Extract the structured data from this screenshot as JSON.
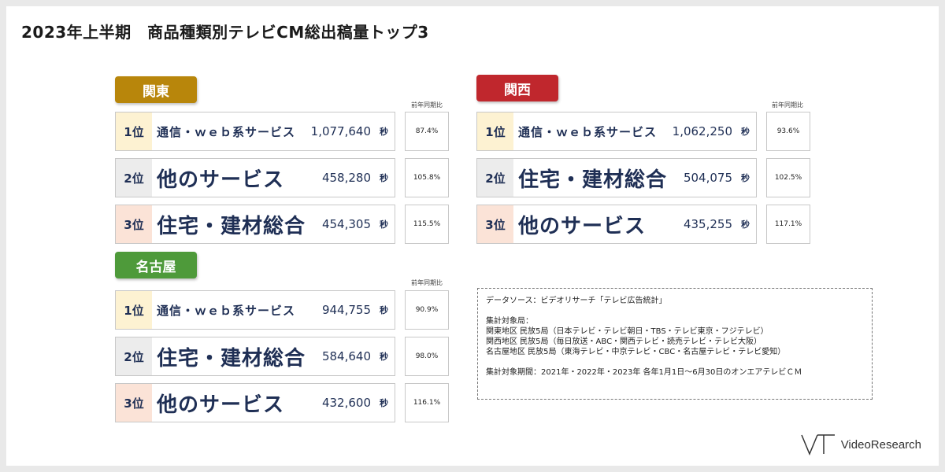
{
  "title": "2023年上半期　商品種類別テレビCM総出稿量トップ3",
  "yoy_header": "前年同期比",
  "seconds_unit": "秒",
  "regions": [
    {
      "name": "関東",
      "color": "#b8860b",
      "rows": [
        {
          "rank": "1位",
          "category": "通信・ｗｅｂ系サービス",
          "seconds": "1,077,640",
          "yoy": "87.4%"
        },
        {
          "rank": "2位",
          "category": "他のサービス",
          "seconds": "458,280",
          "yoy": "105.8%"
        },
        {
          "rank": "3位",
          "category": "住宅・建材総合",
          "seconds": "454,305",
          "yoy": "115.5%"
        }
      ]
    },
    {
      "name": "関西",
      "color": "#c0272d",
      "rows": [
        {
          "rank": "1位",
          "category": "通信・ｗｅｂ系サービス",
          "seconds": "1,062,250",
          "yoy": "93.6%"
        },
        {
          "rank": "2位",
          "category": "住宅・建材総合",
          "seconds": "504,075",
          "yoy": "102.5%"
        },
        {
          "rank": "3位",
          "category": "他のサービス",
          "seconds": "435,255",
          "yoy": "117.1%"
        }
      ]
    },
    {
      "name": "名古屋",
      "color": "#4e9a3a",
      "rows": [
        {
          "rank": "1位",
          "category": "通信・ｗｅｂ系サービス",
          "seconds": "944,755",
          "yoy": "90.9%"
        },
        {
          "rank": "2位",
          "category": "住宅・建材総合",
          "seconds": "584,640",
          "yoy": "98.0%"
        },
        {
          "rank": "3位",
          "category": "他のサービス",
          "seconds": "432,600",
          "yoy": "116.1%"
        }
      ]
    }
  ],
  "notes": {
    "source": "データソース：ビデオリサーチ「テレビ広告統計」",
    "stations_header": "集計対象局：",
    "kanto": "関東地区 民放5局（日本テレビ・テレビ朝日・TBS・テレビ東京・フジテレビ）",
    "kansai": "関西地区 民放5局（毎日放送・ABC・関西テレビ・読売テレビ・テレビ大阪）",
    "nagoya": "名古屋地区 民放5局（東海テレビ・中京テレビ・CBC・名古屋テレビ・テレビ愛知）",
    "period": "集計対象期間：2021年・2022年・2023年 各年1月1日～6月30日のオンエアテレビＣＭ"
  },
  "logo": {
    "text": "VideoResearch"
  }
}
